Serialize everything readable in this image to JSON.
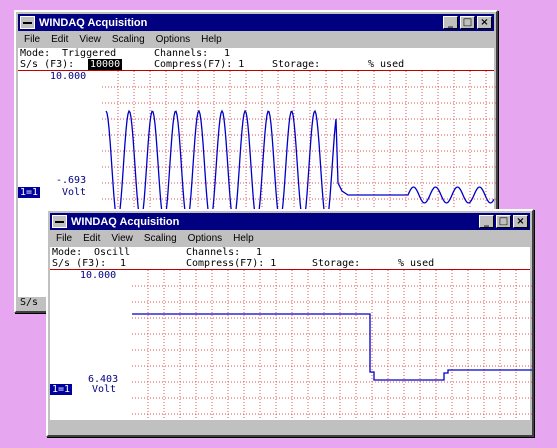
{
  "colors": {
    "desktop": "#e7a6f0",
    "titlebar": "#000080",
    "trace": "#0000c8",
    "grid": "#e05050"
  },
  "back_window": {
    "title": "WINDAQ Acquisition",
    "menu": [
      "File",
      "Edit",
      "View",
      "Scaling",
      "Options",
      "Help"
    ],
    "mode_label": "Mode:",
    "mode_value": "Triggered",
    "channels_label": "Channels:",
    "channels_value": "1",
    "sps_label": "S/s (F3):",
    "sps_value": "10000",
    "compress_label": "Compress(F7): 1",
    "storage_label": "Storage:",
    "storage_suffix": "% used",
    "top_value": "10.000",
    "bottom_value": "-.693",
    "channel": "1=1",
    "unit": "Volt",
    "bottom_text": "S/s"
  },
  "front_window": {
    "title": "WINDAQ Acquisition",
    "menu": [
      "File",
      "Edit",
      "View",
      "Scaling",
      "Options",
      "Help"
    ],
    "mode_label": "Mode:",
    "mode_value": "Oscill",
    "channels_label": "Channels:",
    "channels_value": "1",
    "sps_label": "S/s (F3):",
    "sps_value": "1",
    "compress_label": "Compress(F7): 1",
    "storage_label": "Storage:",
    "storage_suffix": "% used",
    "top_value": "10.000",
    "bottom_value": "6.403",
    "channel": "1=1",
    "unit": "Volt"
  },
  "icons": {
    "minimize": "minimize-icon",
    "maximize": "maximize-icon",
    "close": "close-icon",
    "system": "system-menu-icon"
  }
}
